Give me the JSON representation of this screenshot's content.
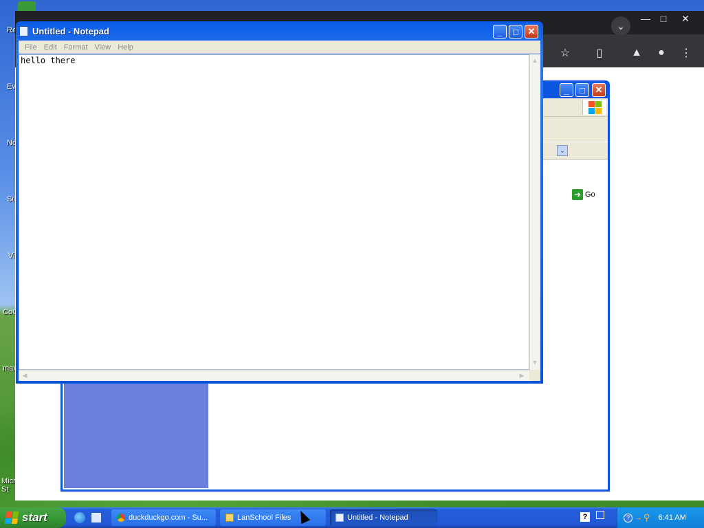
{
  "desktop": {
    "icons": [
      {
        "label": "Re"
      },
      {
        "label": "Ev"
      },
      {
        "label": "No"
      },
      {
        "label": "Su"
      },
      {
        "label": "Vi"
      },
      {
        "label": "CoC"
      },
      {
        "label": "max"
      },
      {
        "label": "Micr St"
      }
    ]
  },
  "ie_window": {
    "go_label": "Go"
  },
  "notepad": {
    "title": "Untitled - Notepad",
    "menu": [
      "File",
      "Edit",
      "Format",
      "View",
      "Help"
    ],
    "content": "hello there"
  },
  "taskbar": {
    "start_label": "start",
    "tasks": [
      {
        "label": "duckduckgo.com - Su..."
      },
      {
        "label": "LanSchool Files"
      },
      {
        "label": "Untitled - Notepad"
      }
    ],
    "clock": "6:41 AM"
  },
  "colors": {
    "xp_blue": "#0a5ae6",
    "start_green": "#379a37",
    "chrome_dark": "#202124"
  }
}
